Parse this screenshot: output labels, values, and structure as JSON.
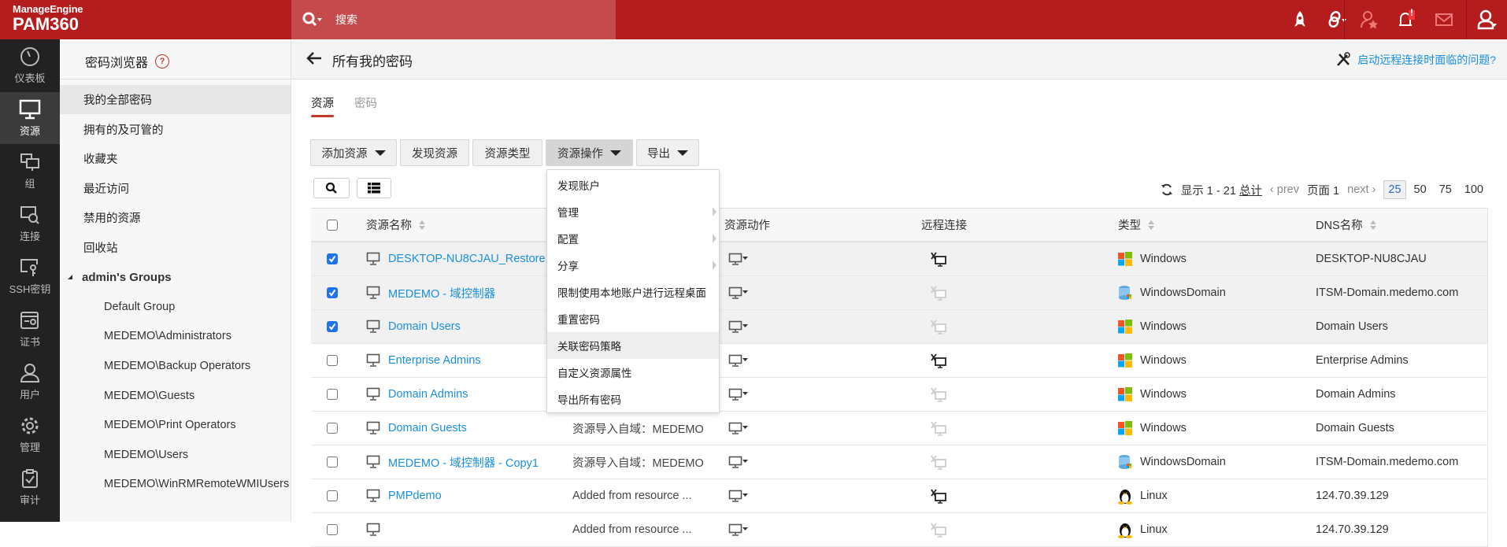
{
  "header": {
    "brand_top": "ManageEngine",
    "brand_product": "PAM360",
    "search_placeholder": "搜索",
    "icons": [
      "rocket-icon",
      "link-icon",
      "user-star-icon",
      "bell-icon",
      "mail-icon",
      "user-icon"
    ],
    "alert_badge": "!"
  },
  "leftbar": [
    {
      "label": "仪表板",
      "icon": "dashboard-icon"
    },
    {
      "label": "资源",
      "icon": "monitor-icon",
      "active": true
    },
    {
      "label": "组",
      "icon": "group-icon"
    },
    {
      "label": "连接",
      "icon": "connection-icon"
    },
    {
      "label": "SSH密钥",
      "icon": "ssh-key-icon"
    },
    {
      "label": "证书",
      "icon": "certificate-icon"
    },
    {
      "label": "用户",
      "icon": "user-icon"
    },
    {
      "label": "管理",
      "icon": "gear-icon"
    },
    {
      "label": "审计",
      "icon": "audit-icon"
    }
  ],
  "nav": {
    "title": "密码浏览器",
    "help": "?",
    "items": [
      {
        "label": "我的全部密码",
        "type": "item",
        "active": true
      },
      {
        "label": "拥有的及可管的",
        "type": "item"
      },
      {
        "label": "收藏夹",
        "type": "item"
      },
      {
        "label": "最近访问",
        "type": "item"
      },
      {
        "label": "禁用的资源",
        "type": "item"
      },
      {
        "label": "回收站",
        "type": "item"
      },
      {
        "label": "admin's Groups",
        "type": "group"
      },
      {
        "label": "Default Group",
        "type": "sub"
      },
      {
        "label": "MEDEMO\\Administrators",
        "type": "sub"
      },
      {
        "label": "MEDEMO\\Backup Operators",
        "type": "sub"
      },
      {
        "label": "MEDEMO\\Guests",
        "type": "sub"
      },
      {
        "label": "MEDEMO\\Print Operators",
        "type": "sub"
      },
      {
        "label": "MEDEMO\\Users",
        "type": "sub"
      },
      {
        "label": "MEDEMO\\WinRMRemoteWMIUsers",
        "type": "sub"
      }
    ]
  },
  "main": {
    "title": "所有我的密码",
    "help_link": "启动远程连接时面临的问题?",
    "tabs": [
      "资源",
      "密码"
    ],
    "toolbar": {
      "add": "添加资源",
      "discover": "发现资源",
      "types": "资源类型",
      "actions": "资源操作",
      "export": "导出"
    },
    "pager": {
      "showing": "显示 1 - 21",
      "total": "总计",
      "prev": "prev",
      "page": "页面 1",
      "next": "next",
      "sizes": [
        "25",
        "50",
        "75",
        "100"
      ],
      "selected_size": "25"
    },
    "columns": {
      "name": "资源名称",
      "actions": "资源动作",
      "remote": "远程连接",
      "type": "类型",
      "dns": "DNS名称"
    },
    "menu": [
      {
        "label": "发现账户"
      },
      {
        "label": "管理",
        "submenu": true
      },
      {
        "label": "配置",
        "submenu": true
      },
      {
        "label": "分享",
        "submenu": true
      },
      {
        "label": "限制使用本地账户进行远程桌面"
      },
      {
        "label": "重置密码"
      },
      {
        "label": "关联密码策略",
        "highlighted": true
      },
      {
        "label": "自定义资源属性"
      },
      {
        "label": "导出所有密码"
      }
    ],
    "rows": [
      {
        "name": "DESKTOP-NU8CJAU_Restore 1",
        "desc": "",
        "checked": true,
        "remote": true,
        "type": "Windows",
        "dns": "DESKTOP-NU8CJAU"
      },
      {
        "name": "MEDEMO - 域控制器",
        "desc": "",
        "checked": true,
        "remote": false,
        "type": "WindowsDomain",
        "dns": "ITSM-Domain.medemo.com"
      },
      {
        "name": "Domain Users",
        "desc": "",
        "checked": true,
        "remote": false,
        "type": "Windows",
        "dns": "Domain Users"
      },
      {
        "name": "Enterprise Admins",
        "desc": "",
        "checked": false,
        "remote": true,
        "type": "Windows",
        "dns": "Enterprise Admins"
      },
      {
        "name": "Domain Admins",
        "desc": "",
        "checked": false,
        "remote": false,
        "type": "Windows",
        "dns": "Domain Admins"
      },
      {
        "name": "Domain Guests",
        "desc": "资源导入自域：MEDEMO",
        "checked": false,
        "remote": false,
        "type": "Windows",
        "dns": "Domain Guests"
      },
      {
        "name": "MEDEMO - 域控制器 - Copy1",
        "desc": "资源导入自域：MEDEMO",
        "checked": false,
        "remote": false,
        "type": "WindowsDomain",
        "dns": "ITSM-Domain.medemo.com"
      },
      {
        "name": "PMPdemo",
        "desc": "Added from resource ...",
        "checked": false,
        "remote": true,
        "type": "Linux",
        "dns": "124.70.39.129"
      },
      {
        "name": "",
        "desc": "Added from resource ...",
        "checked": false,
        "remote": false,
        "type": "Linux",
        "dns": "124.70.39.129"
      }
    ]
  },
  "colors": {
    "brand_red": "#b41c1e",
    "search_bg": "#c54a4b",
    "link": "#1a8fdc",
    "checkbox": "#1e73e8"
  }
}
